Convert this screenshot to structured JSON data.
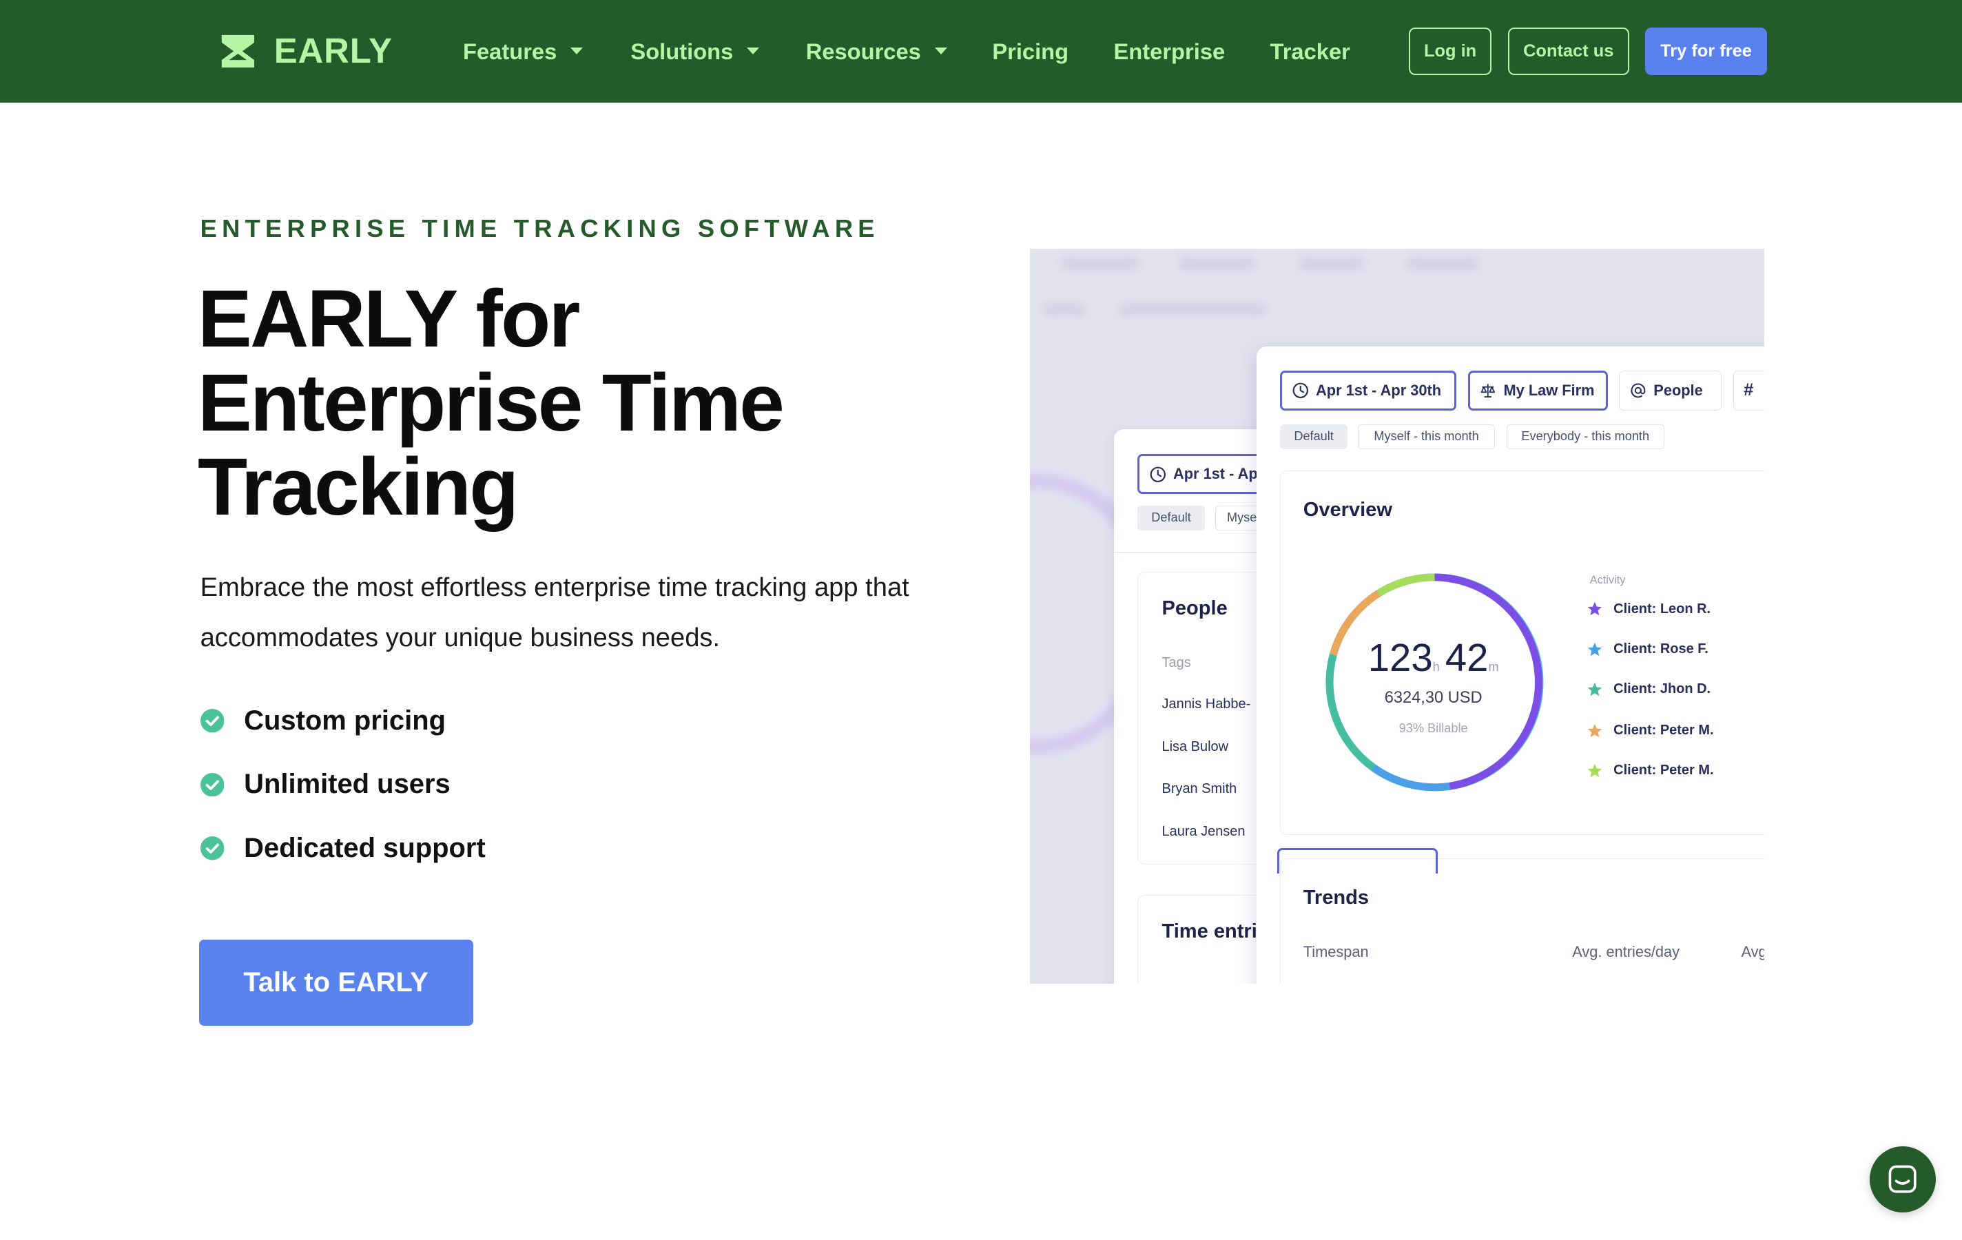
{
  "nav": {
    "logo_text": "EARLY",
    "items": [
      {
        "label": "Features"
      },
      {
        "label": "Solutions"
      },
      {
        "label": "Resources"
      },
      {
        "label": "Pricing"
      },
      {
        "label": "Enterprise"
      },
      {
        "label": "Tracker"
      }
    ],
    "login_label": "Log in",
    "contact_label": "Contact us",
    "try_label": "Try for free"
  },
  "hero": {
    "eyebrow": "ENTERPRISE TIME TRACKING SOFTWARE",
    "title": "EARLY for Enterprise Time Tracking",
    "subtitle": "Embrace the most effortless enterprise time tracking app that accommodates your unique business needs.",
    "features": [
      {
        "label": "Custom pricing"
      },
      {
        "label": "Unlimited users"
      },
      {
        "label": "Dedicated support"
      }
    ],
    "cta_label": "Talk to EARLY"
  },
  "mock": {
    "back_panel": {
      "date_chip": "Apr 1st - Apr",
      "tags": [
        "Default",
        "Myse"
      ],
      "people_title": "People",
      "tags_label": "Tags",
      "people": [
        "Jannis Habbe-",
        "Lisa Bulow",
        "Bryan Smith",
        "Laura Jensen"
      ],
      "time_entries_title": "Time entri"
    },
    "front_panel": {
      "date_chip": "Apr 1st - Apr 30th",
      "client_chip": "My Law Firm",
      "people_chip": "People",
      "hash_chip": "#",
      "tags": [
        "Default",
        "Myself - this month",
        "Everybody - this month"
      ],
      "overview_title": "Overview",
      "hours": "123",
      "hours_unit": "h",
      "minutes": "42",
      "minutes_unit": "m",
      "amount": "6324,30 USD",
      "billable": "93% Billable",
      "activity_label": "Activity",
      "activity": [
        {
          "label": "Client: Leon R.",
          "color": "#7b4fe6"
        },
        {
          "label": "Client: Rose F.",
          "color": "#4a9fe8"
        },
        {
          "label": "Client: Jhon D.",
          "color": "#47bda0"
        },
        {
          "label": "Client: Peter M.",
          "color": "#e8a75a"
        },
        {
          "label": "Client: Peter M.",
          "color": "#a5dc5a"
        }
      ],
      "trends_title": "Trends",
      "trends_columns": [
        "Timespan",
        "Avg. entries/day",
        "Avg"
      ]
    }
  },
  "colors": {
    "brand_green": "#255a2b",
    "brand_lime": "#b5f6a4",
    "accent_blue": "#5a82ef"
  }
}
